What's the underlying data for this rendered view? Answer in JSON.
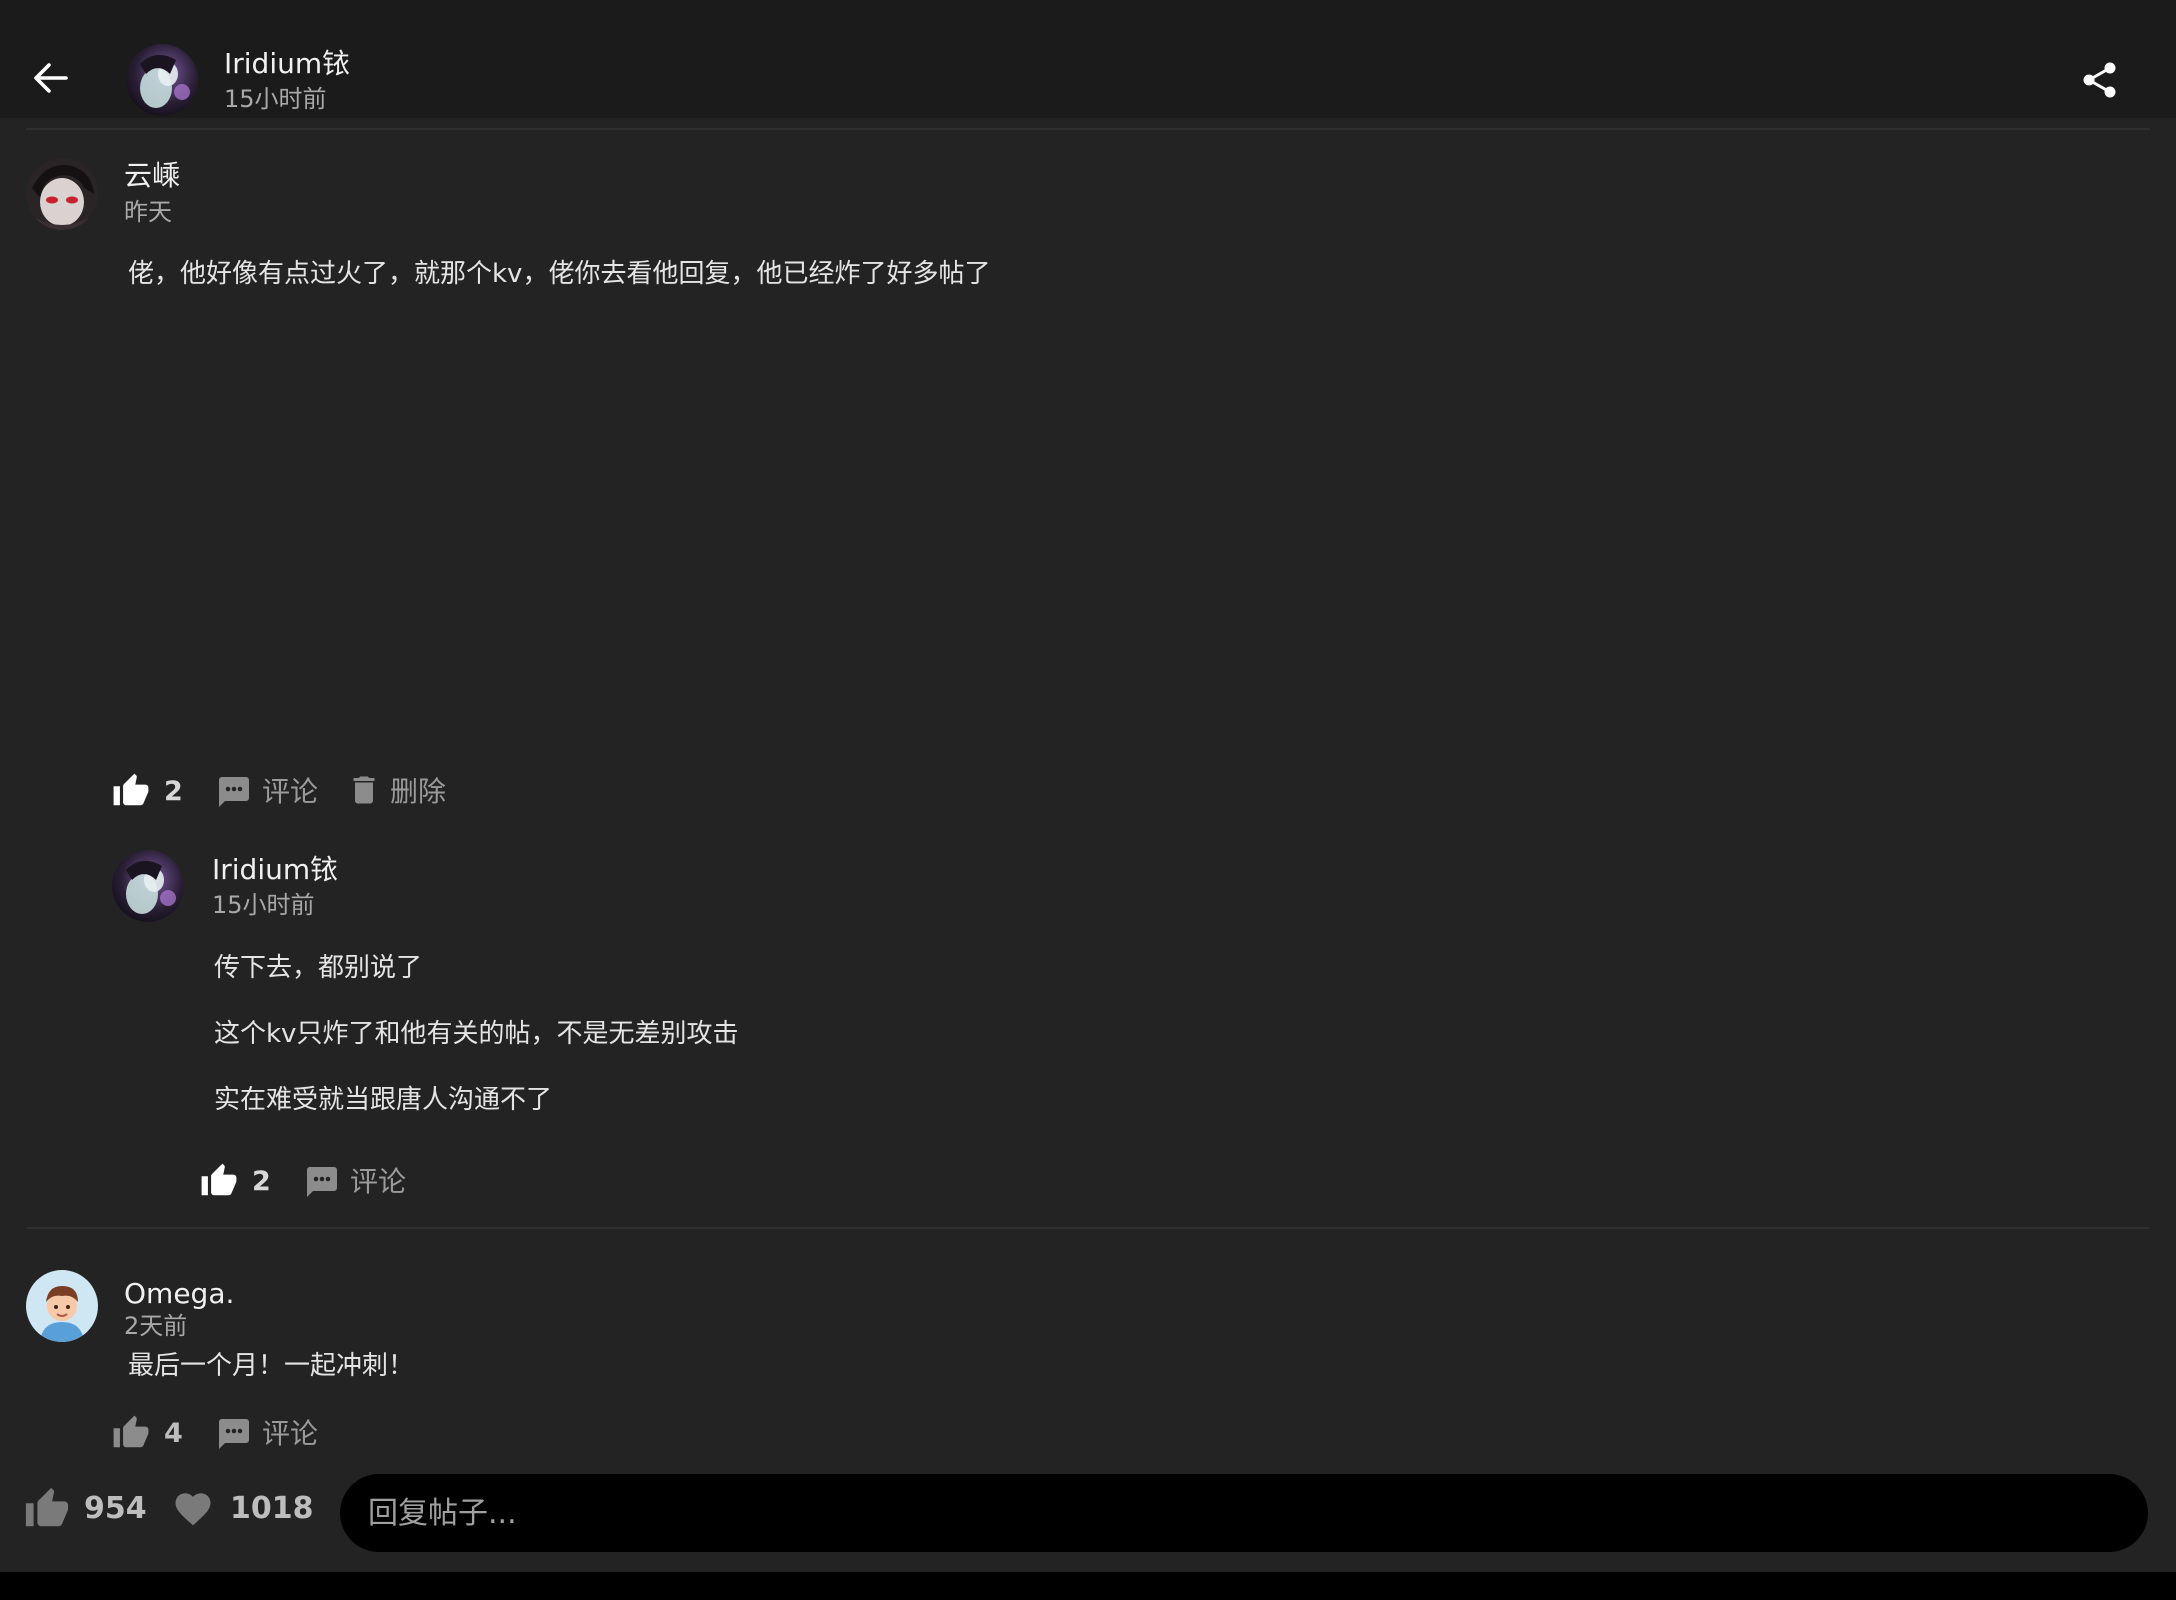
{
  "header": {
    "author_name": "Iridium铱",
    "time": "15小时前",
    "back_icon": "arrow-left-icon",
    "share_icon": "share-icon"
  },
  "comment1": {
    "author": "云嵊",
    "time": "昨天",
    "text": "佬，他好像有点过火了，就那个kv，佬你去看他回复，他已经炸了好多帖了",
    "likes": "2",
    "comment_label": "评论",
    "delete_label": "删除",
    "reply": {
      "author": "Iridium铱",
      "time": "15小时前",
      "lines": [
        "传下去，都别说了",
        "这个kv只炸了和他有关的帖，不是无差别攻击",
        "实在难受就当跟唐人沟通不了"
      ],
      "likes": "2",
      "comment_label": "评论"
    }
  },
  "comment2": {
    "author": "Omega.",
    "time": "2天前",
    "text": "最后一个月！一起冲刺！",
    "likes": "4",
    "comment_label": "评论"
  },
  "bottom": {
    "likes": "954",
    "favorites": "1018",
    "reply_placeholder": "回复帖子..."
  },
  "colors": {
    "background": "#232323",
    "topbar": "#1b1b1b",
    "input_background": "#000000",
    "text_primary": "#f0f0f0",
    "text_secondary": "#a8a8a8"
  }
}
